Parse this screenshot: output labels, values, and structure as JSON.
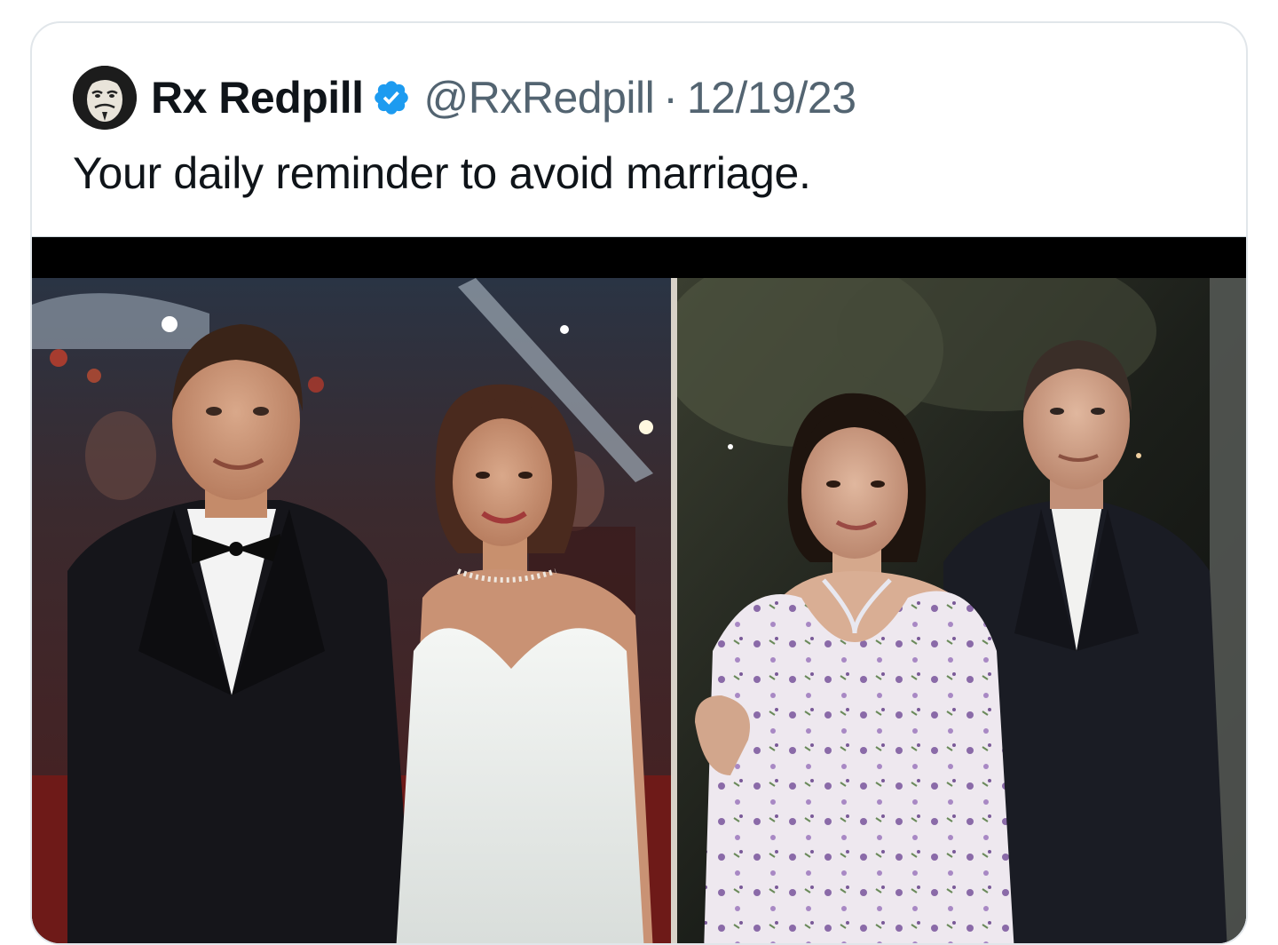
{
  "tweet": {
    "display_name": "Rx Redpill",
    "verified": true,
    "handle": "@RxRedpill",
    "separator": "·",
    "date": "12/19/23",
    "text": "Your daily reminder to avoid marriage."
  },
  "icons": {
    "avatar": "guy-fawkes-mask-avatar",
    "verified": "verified-badge-icon"
  },
  "colors": {
    "text_primary": "#0f1419",
    "text_secondary": "#536471",
    "verified_blue": "#1d9bf0",
    "card_border": "#e1e6ea"
  },
  "media": {
    "type": "side-by-side photo collage",
    "panels": 2
  }
}
